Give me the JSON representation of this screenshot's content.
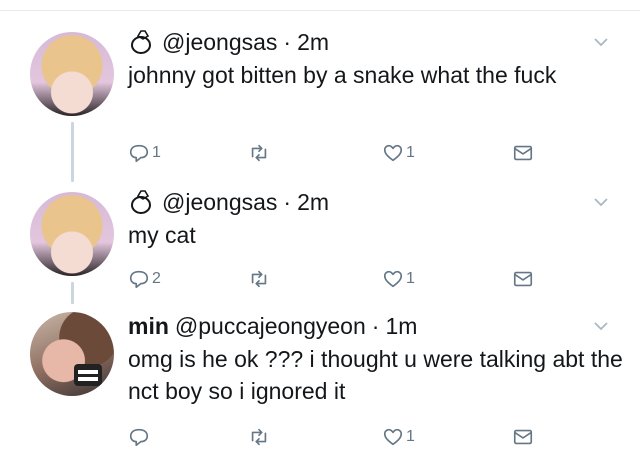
{
  "tweets": [
    {
      "author_name": "",
      "handle": "@jeongsas",
      "separator": "·",
      "time": "2m",
      "text": "johnny got bitten by a snake what the fuck",
      "reply_count": "1",
      "retweet_count": "",
      "like_count": "1"
    },
    {
      "author_name": "",
      "handle": "@jeongsas",
      "separator": "·",
      "time": "2m",
      "text": "my cat",
      "reply_count": "2",
      "retweet_count": "",
      "like_count": "1"
    },
    {
      "author_name": "min",
      "handle": "@puccajeongyeon",
      "separator": "·",
      "time": "1m",
      "text": "omg is he ok ??? i thought u were talking abt the nct boy so i ignored it",
      "reply_count": "",
      "retweet_count": "",
      "like_count": "1"
    }
  ],
  "icons": {
    "badge": "ring-icon",
    "menu": "chevron-down-icon",
    "reply": "reply-icon",
    "retweet": "retweet-icon",
    "like": "heart-icon",
    "dm": "envelope-icon"
  },
  "colors": {
    "icon_gray": "#657786",
    "text": "#14171a",
    "thread_line": "#ccd6dd"
  }
}
